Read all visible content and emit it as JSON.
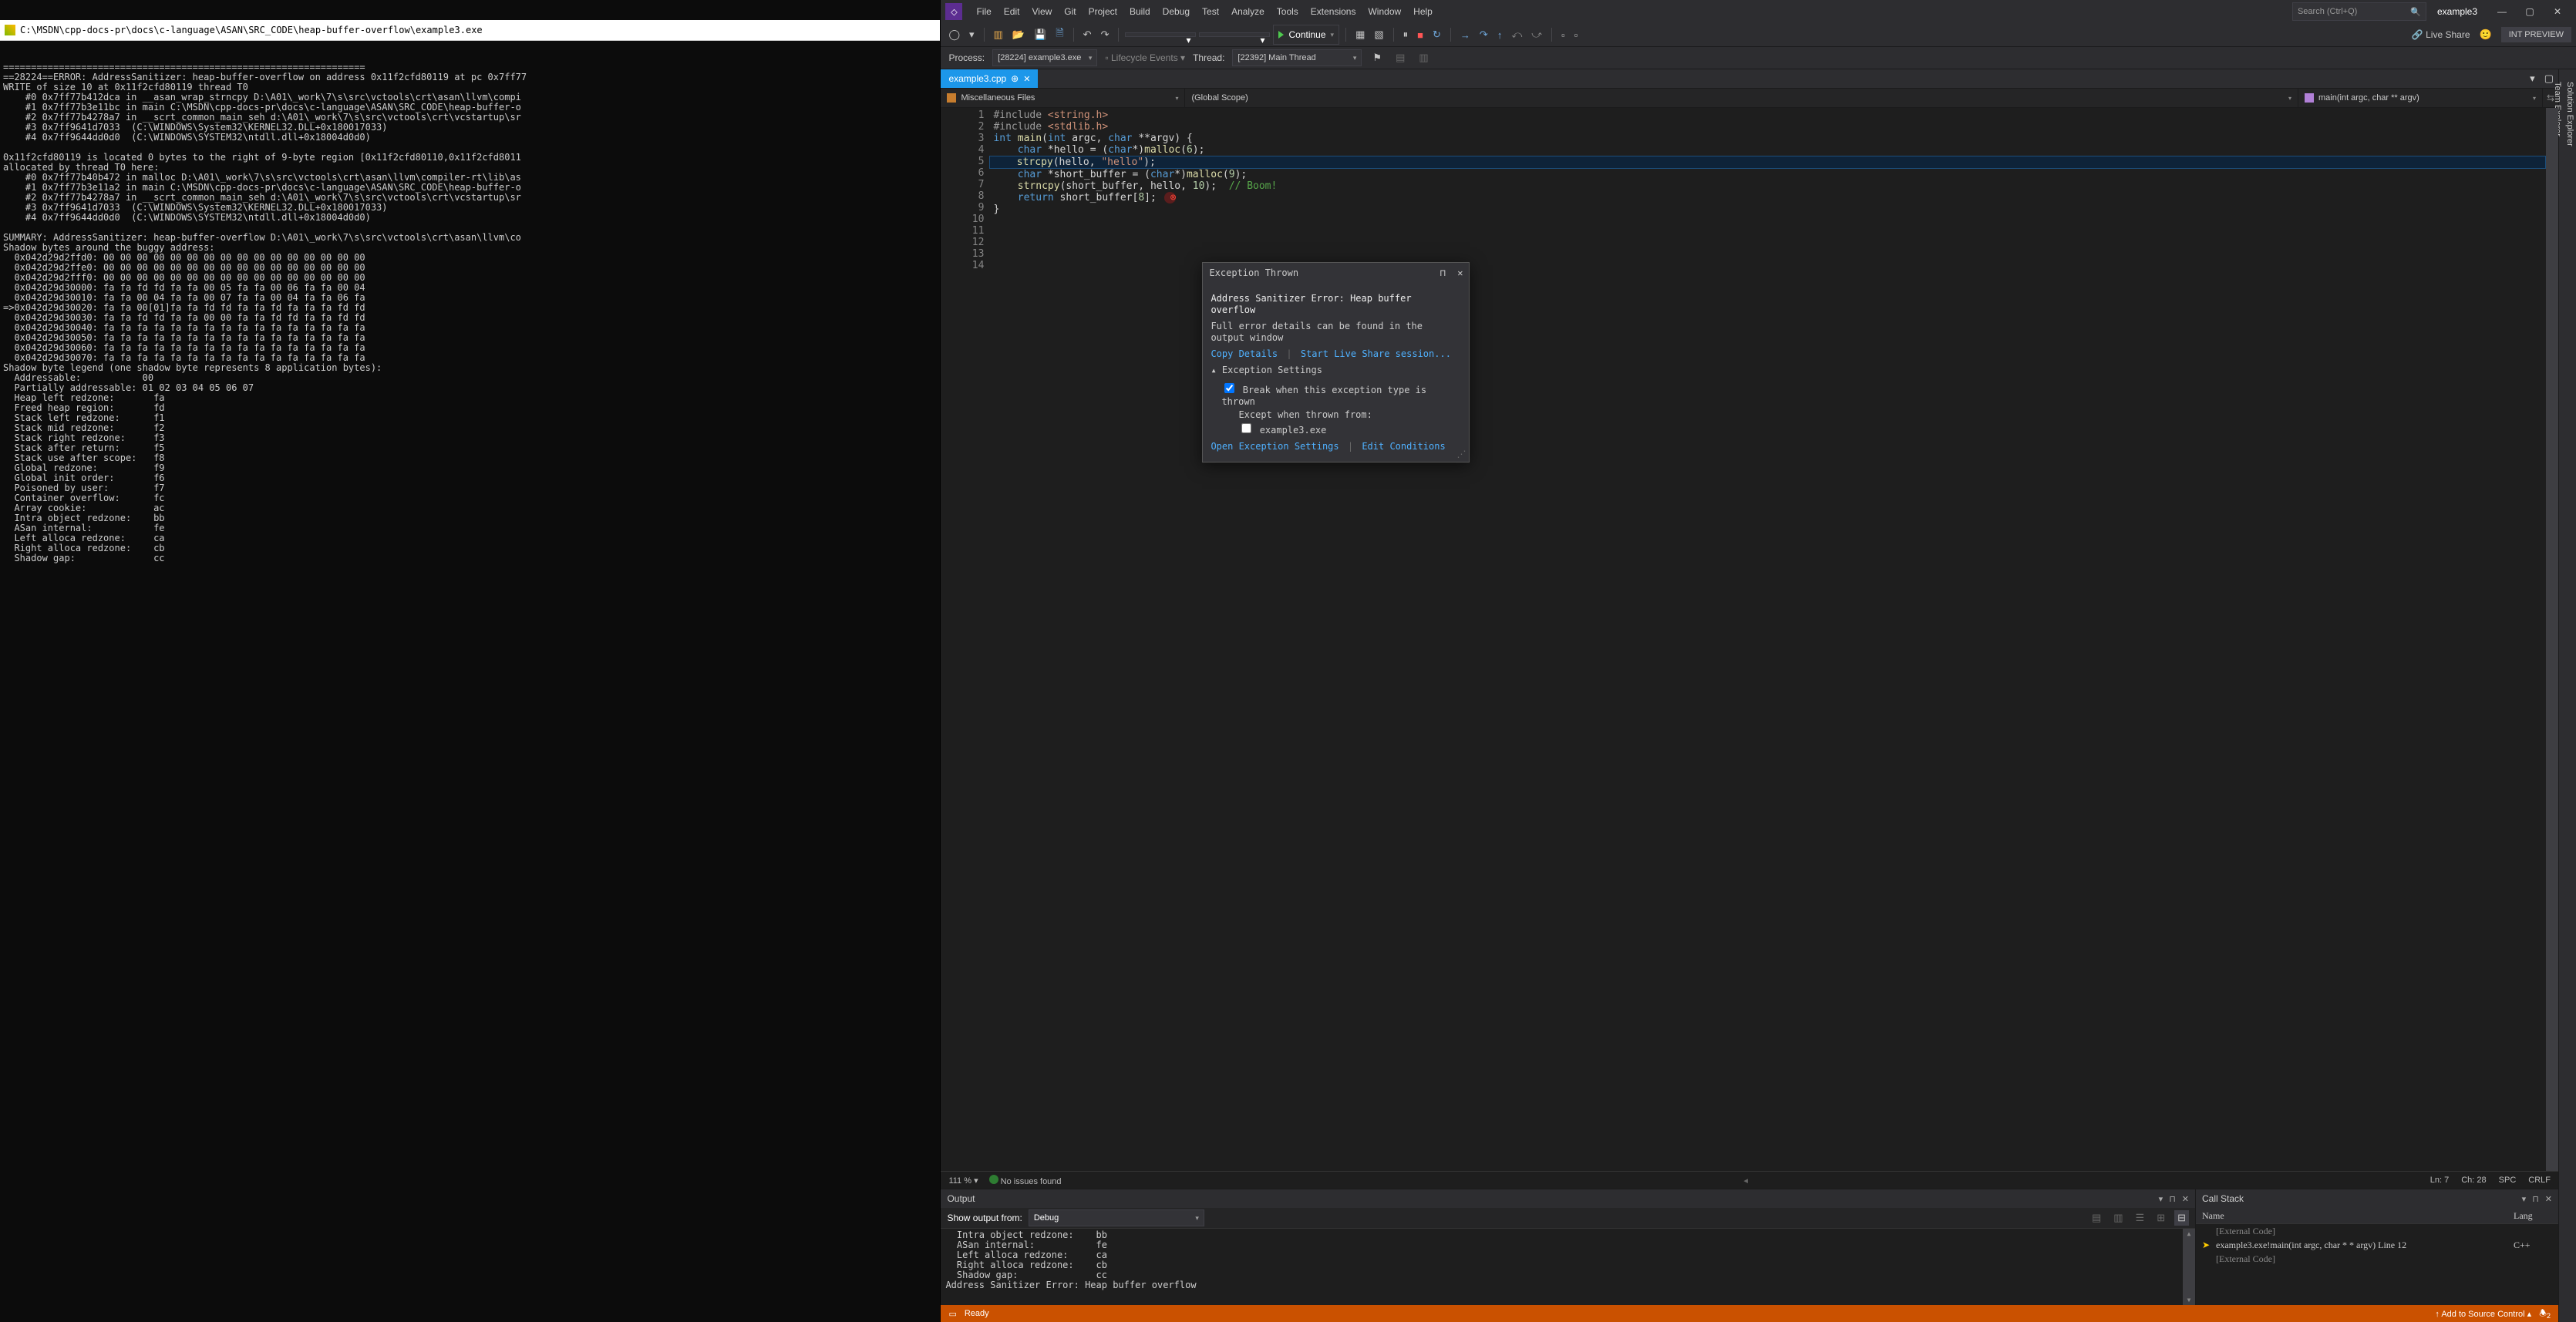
{
  "console": {
    "title": "C:\\MSDN\\cpp-docs-pr\\docs\\c-language\\ASAN\\SRC_CODE\\heap-buffer-overflow\\example3.exe",
    "body": "=================================================================\n==28224==ERROR: AddressSanitizer: heap-buffer-overflow on address 0x11f2cfd80119 at pc 0x7ff77\nWRITE of size 10 at 0x11f2cfd80119 thread T0\n    #0 0x7ff77b412dca in __asan_wrap_strncpy D:\\A01\\_work\\7\\s\\src\\vctools\\crt\\asan\\llvm\\compi\n    #1 0x7ff77b3e11bc in main C:\\MSDN\\cpp-docs-pr\\docs\\c-language\\ASAN\\SRC_CODE\\heap-buffer-o\n    #2 0x7ff77b4278a7 in __scrt_common_main_seh d:\\A01\\_work\\7\\s\\src\\vctools\\crt\\vcstartup\\sr\n    #3 0x7ff9641d7033  (C:\\WINDOWS\\System32\\KERNEL32.DLL+0x180017033)\n    #4 0x7ff9644dd0d0  (C:\\WINDOWS\\SYSTEM32\\ntdll.dll+0x18004d0d0)\n\n0x11f2cfd80119 is located 0 bytes to the right of 9-byte region [0x11f2cfd80110,0x11f2cfd8011\nallocated by thread T0 here:\n    #0 0x7ff77b40b472 in malloc D:\\A01\\_work\\7\\s\\src\\vctools\\crt\\asan\\llvm\\compiler-rt\\lib\\as\n    #1 0x7ff77b3e11a2 in main C:\\MSDN\\cpp-docs-pr\\docs\\c-language\\ASAN\\SRC_CODE\\heap-buffer-o\n    #2 0x7ff77b4278a7 in __scrt_common_main_seh d:\\A01\\_work\\7\\s\\src\\vctools\\crt\\vcstartup\\sr\n    #3 0x7ff9641d7033  (C:\\WINDOWS\\System32\\KERNEL32.DLL+0x180017033)\n    #4 0x7ff9644dd0d0  (C:\\WINDOWS\\SYSTEM32\\ntdll.dll+0x18004d0d0)\n\nSUMMARY: AddressSanitizer: heap-buffer-overflow D:\\A01\\_work\\7\\s\\src\\vctools\\crt\\asan\\llvm\\co\nShadow bytes around the buggy address:\n  0x042d29d2ffd0: 00 00 00 00 00 00 00 00 00 00 00 00 00 00 00 00\n  0x042d29d2ffe0: 00 00 00 00 00 00 00 00 00 00 00 00 00 00 00 00\n  0x042d29d2fff0: 00 00 00 00 00 00 00 00 00 00 00 00 00 00 00 00\n  0x042d29d30000: fa fa fd fd fa fa 00 05 fa fa 00 06 fa fa 00 04\n  0x042d29d30010: fa fa 00 04 fa fa 00 07 fa fa 00 04 fa fa 06 fa\n=>0x042d29d30020: fa fa 00[01]fa fa fd fd fa fa fd fa fa fa fd fd\n  0x042d29d30030: fa fa fd fd fa fa 00 00 fa fa fd fd fa fa fd fd\n  0x042d29d30040: fa fa fa fa fa fa fa fa fa fa fa fa fa fa fa fa\n  0x042d29d30050: fa fa fa fa fa fa fa fa fa fa fa fa fa fa fa fa\n  0x042d29d30060: fa fa fa fa fa fa fa fa fa fa fa fa fa fa fa fa\n  0x042d29d30070: fa fa fa fa fa fa fa fa fa fa fa fa fa fa fa fa\nShadow byte legend (one shadow byte represents 8 application bytes):\n  Addressable:           00\n  Partially addressable: 01 02 03 04 05 06 07\n  Heap left redzone:       fa\n  Freed heap region:       fd\n  Stack left redzone:      f1\n  Stack mid redzone:       f2\n  Stack right redzone:     f3\n  Stack after return:      f5\n  Stack use after scope:   f8\n  Global redzone:          f9\n  Global init order:       f6\n  Poisoned by user:        f7\n  Container overflow:      fc\n  Array cookie:            ac\n  Intra object redzone:    bb\n  ASan internal:           fe\n  Left alloca redzone:     ca\n  Right alloca redzone:    cb\n  Shadow gap:              cc\n"
  },
  "menu": {
    "items": [
      "File",
      "Edit",
      "View",
      "Git",
      "Project",
      "Build",
      "Debug",
      "Test",
      "Analyze",
      "Tools",
      "Extensions",
      "Window",
      "Help"
    ],
    "search_placeholder": "Search (Ctrl+Q)",
    "solution": "example3"
  },
  "toolbar": {
    "continue": "Continue",
    "liveshare": "Live Share",
    "intpreview": "INT PREVIEW"
  },
  "debugbar": {
    "process_label": "Process:",
    "process": "[28224] example3.exe",
    "events": "Lifecycle Events",
    "thread_label": "Thread:",
    "thread": "[22392] Main Thread"
  },
  "tab": {
    "name": "example3.cpp"
  },
  "breadcrumbs": {
    "a": "Miscellaneous Files",
    "b": "(Global Scope)",
    "c": "main(int argc, char ** argv)"
  },
  "code": {
    "lines": [
      [
        [
          "pre",
          "#include "
        ],
        [
          "str",
          "<string.h>"
        ]
      ],
      [
        [
          "pre",
          "#include "
        ],
        [
          "str",
          "<stdlib.h>"
        ]
      ],
      [
        [
          "pln",
          ""
        ]
      ],
      [
        [
          "key",
          "int "
        ],
        [
          "fn",
          "main"
        ],
        [
          "pln",
          "("
        ],
        [
          "key",
          "int"
        ],
        [
          "pln",
          " argc, "
        ],
        [
          "key",
          "char"
        ],
        [
          "pln",
          " **argv) {"
        ]
      ],
      [
        [
          "pln",
          ""
        ]
      ],
      [
        [
          "pln",
          "    "
        ],
        [
          "key",
          "char"
        ],
        [
          "pln",
          " *hello = ("
        ],
        [
          "key",
          "char"
        ],
        [
          "pln",
          "*)"
        ],
        [
          "fn",
          "malloc"
        ],
        [
          "pln",
          "("
        ],
        [
          "num",
          "6"
        ],
        [
          "pln",
          ");"
        ]
      ],
      [
        [
          "pln",
          "    "
        ],
        [
          "fn",
          "strcpy"
        ],
        [
          "pln",
          "(hello, "
        ],
        [
          "str",
          "\"hello\""
        ],
        [
          "pln",
          ");"
        ]
      ],
      [
        [
          "pln",
          ""
        ]
      ],
      [
        [
          "pln",
          "    "
        ],
        [
          "key",
          "char"
        ],
        [
          "pln",
          " *short_buffer = ("
        ],
        [
          "key",
          "char"
        ],
        [
          "pln",
          "*)"
        ],
        [
          "fn",
          "malloc"
        ],
        [
          "pln",
          "("
        ],
        [
          "num",
          "9"
        ],
        [
          "pln",
          ");"
        ]
      ],
      [
        [
          "pln",
          "    "
        ],
        [
          "fn",
          "strncpy"
        ],
        [
          "pln",
          "(short_buffer, hello, "
        ],
        [
          "num",
          "10"
        ],
        [
          "pln",
          ");  "
        ],
        [
          "cmt",
          "// Boom!"
        ]
      ],
      [
        [
          "pln",
          ""
        ]
      ],
      [
        [
          "pln",
          "    "
        ],
        [
          "key",
          "return"
        ],
        [
          "pln",
          " short_buffer["
        ],
        [
          "num",
          "8"
        ],
        [
          "pln",
          "];"
        ]
      ],
      [
        [
          "pln",
          "}"
        ]
      ],
      [
        [
          "pln",
          ""
        ]
      ]
    ],
    "highlight": 7,
    "error_line": 12
  },
  "exception": {
    "title": "Exception Thrown",
    "msg": "Address Sanitizer Error: Heap buffer overflow",
    "detail": "Full error details can be found in the output window",
    "copy": "Copy Details",
    "liveshare": "Start Live Share session...",
    "settings_hdr": "Exception Settings",
    "break_cb": "Break when this exception type is thrown",
    "except": "Except when thrown from:",
    "except_item": "example3.exe",
    "open": "Open Exception Settings",
    "edit": "Edit Conditions"
  },
  "editstatus": {
    "zoom": "111 %",
    "issues": "No issues found",
    "ln": "Ln: 7",
    "ch": "Ch: 28",
    "spc": "SPC",
    "crlf": "CRLF"
  },
  "output": {
    "title": "Output",
    "from_label": "Show output from:",
    "from": "Debug",
    "body": "  Intra object redzone:    bb\n  ASan internal:           fe\n  Left alloca redzone:     ca\n  Right alloca redzone:    cb\n  Shadow gap:              cc\nAddress Sanitizer Error: Heap buffer overflow"
  },
  "callstack": {
    "title": "Call Stack",
    "col_name": "Name",
    "col_lang": "Lang",
    "rows": [
      {
        "ext": true,
        "name": "[External Code]",
        "lang": ""
      },
      {
        "ext": false,
        "name": "example3.exe!main(int argc, char * * argv) Line 12",
        "lang": "C++"
      },
      {
        "ext": true,
        "name": "[External Code]",
        "lang": ""
      }
    ]
  },
  "status": {
    "ready": "Ready",
    "addsrc": "Add to Source Control"
  },
  "rails": {
    "a": "Solution Explorer",
    "b": "Team Explorer"
  }
}
